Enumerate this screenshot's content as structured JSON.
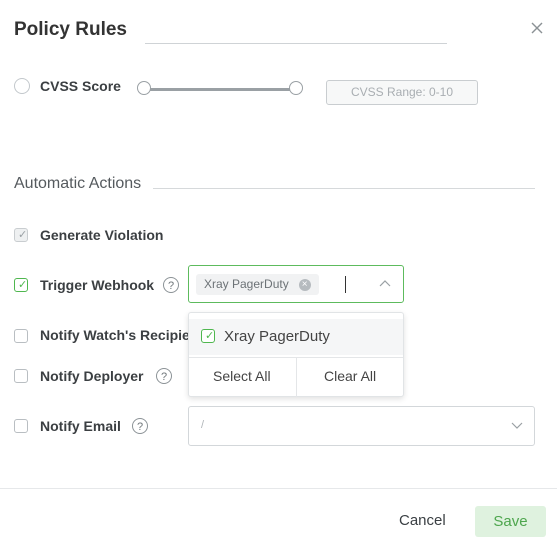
{
  "header": {
    "title": "Policy Rules",
    "close_icon": "close-icon"
  },
  "cvss": {
    "label": "CVSS Score",
    "range_placeholder": "CVSS Range: 0-10"
  },
  "automatic_actions": {
    "section_title": "Automatic Actions",
    "generate_violation": {
      "label": "Generate Violation",
      "checked": true,
      "disabled": true
    },
    "trigger_webhook": {
      "label": "Trigger Webhook",
      "checked": true,
      "help_glyph": "?",
      "selected_tags": [
        "Xray PagerDuty"
      ],
      "tag_remove_glyph": "×",
      "dropdown": {
        "items": [
          {
            "label": "Xray PagerDuty",
            "checked": true
          }
        ],
        "select_all_label": "Select All",
        "clear_all_label": "Clear All"
      }
    },
    "notify_watch": {
      "label": "Notify Watch's Recipie",
      "checked": false
    },
    "notify_deployer": {
      "label": "Notify Deployer",
      "checked": false,
      "help_glyph": "?"
    },
    "notify_email": {
      "label": "Notify Email",
      "checked": false,
      "help_glyph": "?",
      "value": "/"
    }
  },
  "footer": {
    "cancel_label": "Cancel",
    "save_label": "Save"
  },
  "colors": {
    "accent_green": "#5dbb5d",
    "save_bg": "#dff2df",
    "save_text": "#4ea64e"
  }
}
